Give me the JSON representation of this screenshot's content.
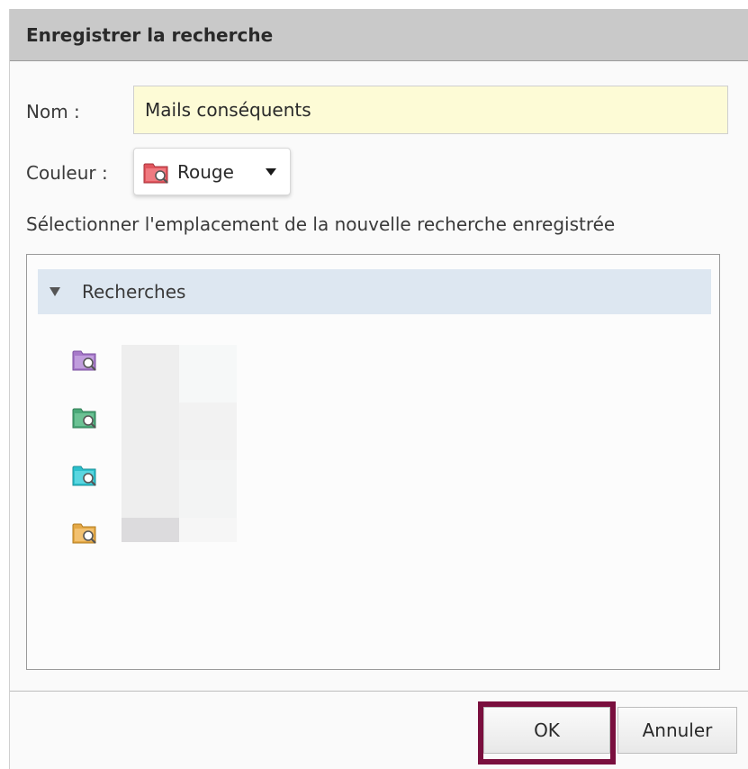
{
  "dialog": {
    "title": "Enregistrer la recherche",
    "name_label": "Nom :",
    "name_value": "Mails conséquents",
    "color_label": "Couleur :",
    "color_value": "Rouge",
    "color_icon": "red-search-folder-icon",
    "location_label": "Sélectionner l'emplacement de la nouvelle recherche enregistrée",
    "tree": {
      "root_label": "Recherches",
      "expanded": true,
      "items": [
        {
          "icon": "purple-search-folder-icon",
          "color": "#a779c9",
          "label": ""
        },
        {
          "icon": "green-search-folder-icon",
          "color": "#4aa878",
          "label": ""
        },
        {
          "icon": "cyan-search-folder-icon",
          "color": "#2cc0cc",
          "label": ""
        },
        {
          "icon": "orange-search-folder-icon",
          "color": "#e4a845",
          "label": ""
        }
      ]
    },
    "ok_label": "OK",
    "cancel_label": "Annuler"
  },
  "colors": {
    "title_bar": "#c9c9c9",
    "input_background": "#fdfbd6",
    "tree_header": "#dde7f1",
    "highlight_outline": "#7a0f3e",
    "selected_color": "#e0555d"
  }
}
